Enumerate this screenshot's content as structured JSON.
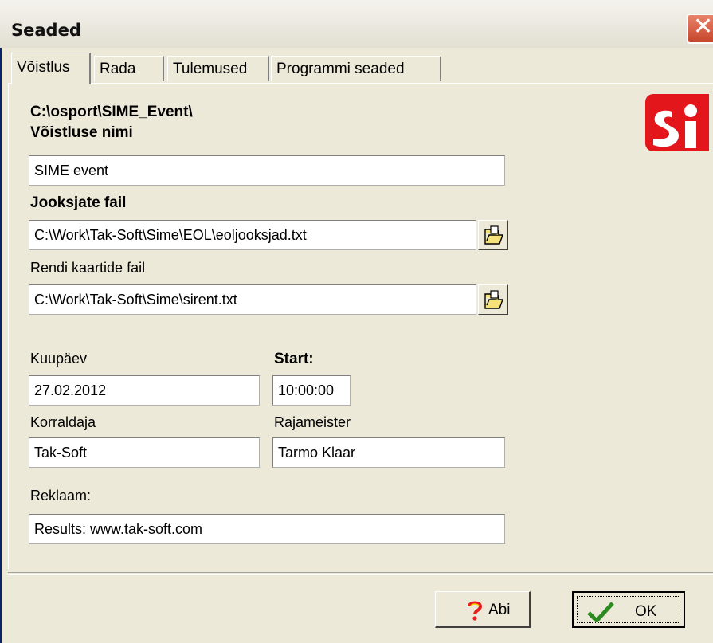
{
  "window": {
    "title": "Seaded",
    "close_icon": "close-icon"
  },
  "tabs": [
    {
      "label": "Võistlus",
      "active": true
    },
    {
      "label": "Rada",
      "active": false
    },
    {
      "label": "Tulemused",
      "active": false
    },
    {
      "label": "Programmi seaded",
      "active": false
    }
  ],
  "event": {
    "path": "C:\\osport\\SIME_Event\\",
    "name_label": "Võistluse nimi",
    "name_value": "SIME event",
    "runners_file_label": "Jooksjate fail",
    "runners_file_value": "C:\\Work\\Tak-Soft\\Sime\\EOL\\eoljooksjad.txt",
    "rental_file_label": "Rendi kaartide fail",
    "rental_file_value": "C:\\Work\\Tak-Soft\\Sime\\sirent.txt",
    "date_label": "Kuupäev",
    "date_value": "27.02.2012",
    "start_label": "Start:",
    "start_value": "10:00:00",
    "organizer_label": "Korraldaja",
    "organizer_value": "Tak-Soft",
    "course_setter_label": "Rajameister",
    "course_setter_value": "Tarmo Klaar",
    "ad_label": "Reklaam:",
    "ad_value": "Results: www.tak-soft.com"
  },
  "logo": {
    "text": "si",
    "color": "#e3161b"
  },
  "buttons": {
    "help_label": "Abi",
    "ok_label": "OK"
  },
  "colors": {
    "face": "#ece9d8",
    "close": "#c6452a",
    "check": "#2a8a1f"
  }
}
